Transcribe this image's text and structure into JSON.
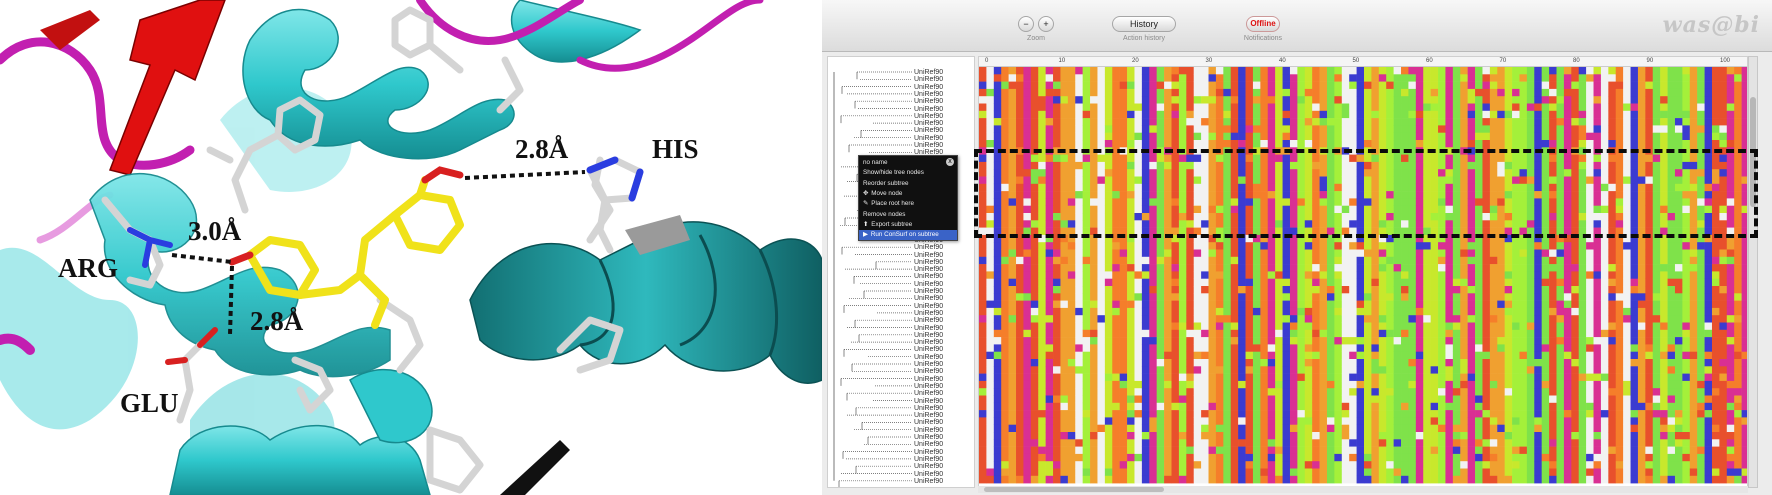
{
  "structure_panel": {
    "labels": {
      "dist_top": "2.8Å",
      "his": "HIS",
      "dist_arg": "3.0Å",
      "arg": "ARG",
      "dist_glu": "2.8Å",
      "glu": "GLU"
    },
    "colors": {
      "helix": "#2fc8cc",
      "helix_dark": "#1e9ea1",
      "sheet": "#e01010",
      "loop": "#c21fb0",
      "ligand": "#f0e21a",
      "sidechain": "#d4d4d4",
      "nitrogen": "#2a3de0",
      "oxygen": "#d82020"
    }
  },
  "alignment_viewer": {
    "app_logo": "was@bi",
    "toolbar": {
      "zoom_out": "−",
      "zoom_in": "+",
      "zoom_caption": "Zoom",
      "history_label": "History",
      "history_caption": "Action history",
      "offline_label": "Offline",
      "offline_caption": "Notifications"
    },
    "ruler_ticks": [
      "0",
      "10",
      "20",
      "30",
      "40",
      "50",
      "60",
      "70",
      "80",
      "90",
      "100"
    ],
    "sequence_name": "UniRef90",
    "context_menu": {
      "items": [
        {
          "label": "no name",
          "icon": ""
        },
        {
          "label": "Show/hide tree nodes",
          "icon": ""
        },
        {
          "label": "Reorder subtree",
          "icon": ""
        },
        {
          "label": "Move node",
          "icon": "move-icon"
        },
        {
          "label": "Place root here",
          "icon": "root-icon"
        },
        {
          "label": "Remove nodes",
          "icon": ""
        },
        {
          "label": "Export subtree",
          "icon": "export-icon"
        },
        {
          "label": "Run ConSurf on subtree",
          "icon": "run-icon"
        }
      ],
      "highlighted_index": 7,
      "close_glyph": "x"
    },
    "residue_palette": [
      "#7fe24a",
      "#a4f03a",
      "#f0a030",
      "#e8502c",
      "#d92f93",
      "#3b3bd0",
      "#f2f2f2",
      "#c8e82c",
      "#f57e2a"
    ]
  }
}
